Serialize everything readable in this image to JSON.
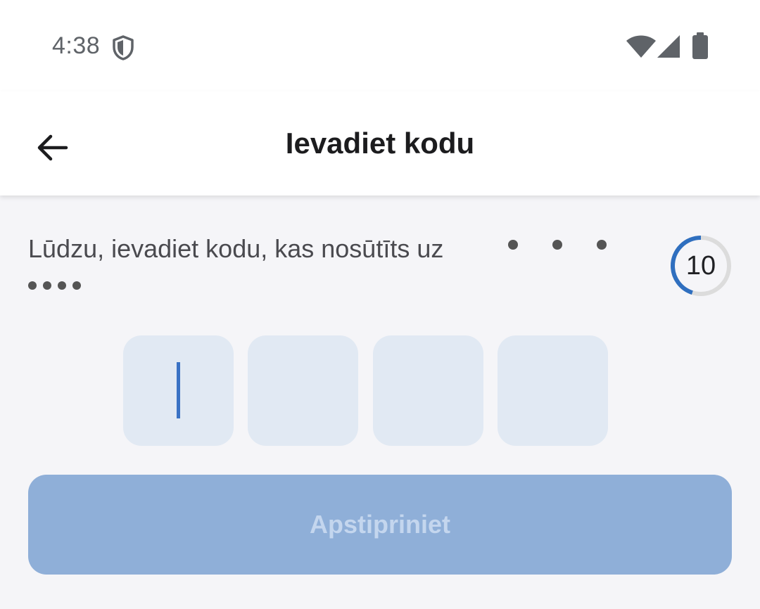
{
  "status_bar": {
    "time": "4:38",
    "icons": [
      "shield-icon",
      "wifi-icon",
      "signal-icon",
      "battery-icon"
    ]
  },
  "app_bar": {
    "back_icon": "arrow-left-icon",
    "title": "Ievadiet kodu"
  },
  "content": {
    "instruction": "Lūdzu, ievadiet kodu, kas nosūtīts uz",
    "masked_phone": "• • • ••••",
    "timer": {
      "seconds": "10",
      "progress_fraction": 0.45,
      "accent_color": "#2f6fbf"
    },
    "code_boxes": [
      "",
      "",
      "",
      ""
    ],
    "active_box_index": 0,
    "confirm_button_label": "Apstipriniet"
  },
  "colors": {
    "background": "#f5f5f8",
    "code_box": "#e1e9f3",
    "button_disabled": "#8fafd8",
    "button_text_disabled": "#c4d6ee"
  }
}
